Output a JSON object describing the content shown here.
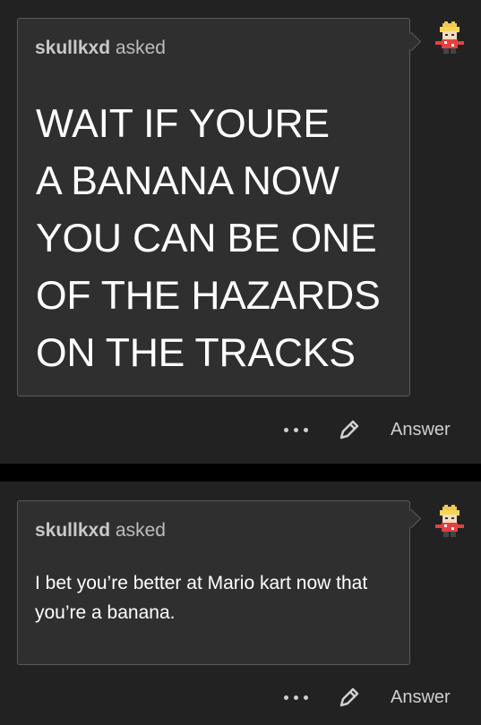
{
  "posts": [
    {
      "asker_name": "skullkxd",
      "asked_word": "asked",
      "question_lines": [
        "WAIT IF YOURE",
        "A BANANA NOW",
        "YOU CAN BE ONE",
        "OF THE HAZARDS",
        "ON THE TRACKS"
      ],
      "actions": {
        "more_icon": "more-dots-icon",
        "edit_icon": "pencil-icon",
        "answer_label": "Answer"
      }
    },
    {
      "asker_name": "skullkxd",
      "asked_word": "asked",
      "question": "I bet you’re better at Mario kart now that you’re a banana.",
      "actions": {
        "more_icon": "more-dots-icon",
        "edit_icon": "pencil-icon",
        "answer_label": "Answer"
      }
    }
  ],
  "colors": {
    "page_background": "#000000",
    "post_background": "#222222",
    "bubble_background": "#2f2f2f",
    "bubble_border": "#5a5a5a",
    "text_primary": "#ffffff",
    "text_secondary": "#bdbdbd"
  }
}
